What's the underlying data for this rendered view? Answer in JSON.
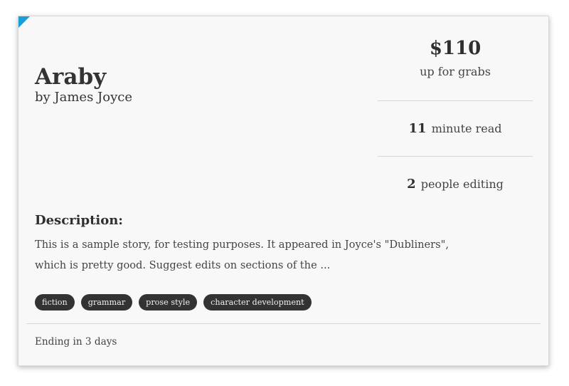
{
  "story": {
    "title": "Araby",
    "author": "by James Joyce"
  },
  "stats": {
    "reward_amount": "$110",
    "reward_label": "up for grabs",
    "read_time_value": "11",
    "read_time_label": "minute read",
    "editors_value": "2",
    "editors_label": "people editing"
  },
  "description": {
    "heading": "Description:",
    "text": "This is a sample story, for testing purposes. It appeared in Joyce's \"Dubliners\", which is pretty good. Suggest edits on sections of the ..."
  },
  "tags": [
    "fiction",
    "grammar",
    "prose style",
    "character development"
  ],
  "footer": {
    "ending": "Ending in 3 days"
  },
  "colors": {
    "accent": "#1a9ed6",
    "tag_background": "#333333",
    "card_background": "#f8f8f8"
  }
}
